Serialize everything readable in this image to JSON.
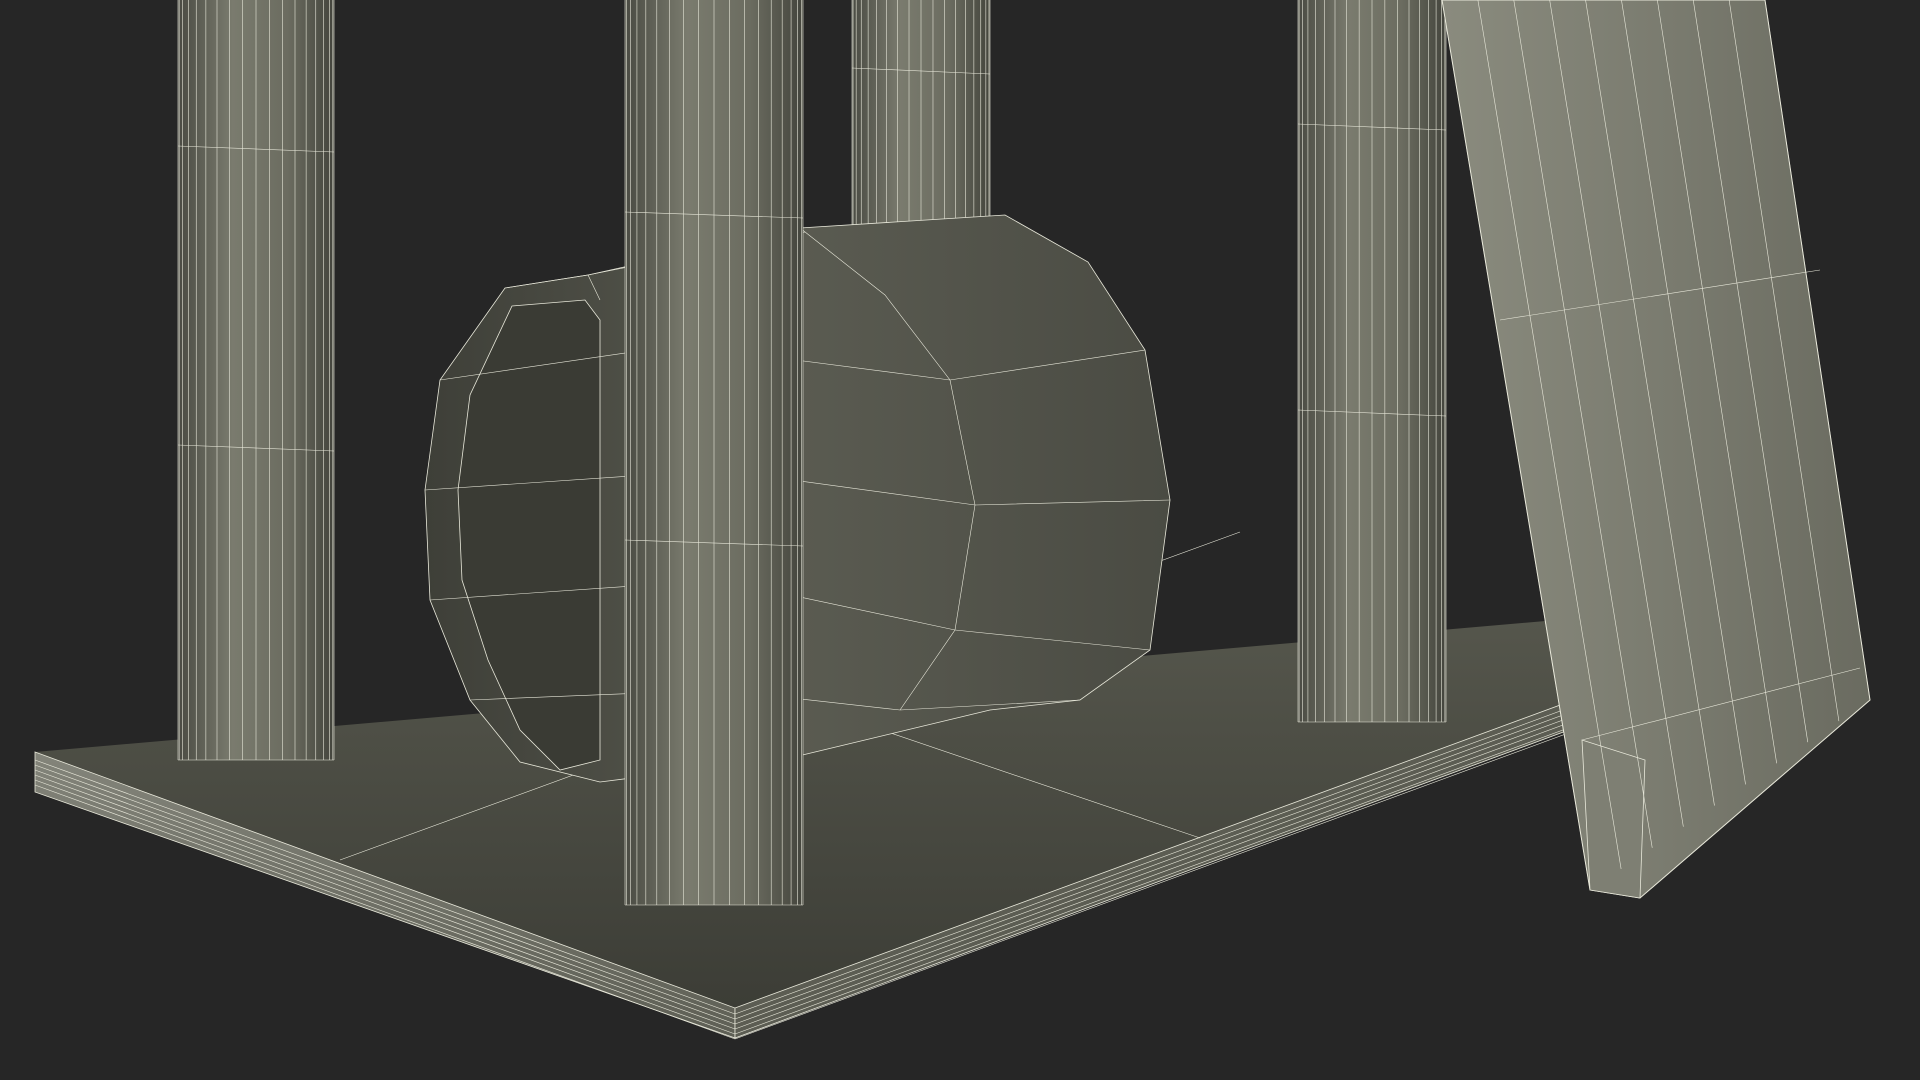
{
  "scene": {
    "background_color": "#262626",
    "surface_color": "#6f7064",
    "wire_color": "#e8e8da",
    "objects": [
      "base-platform",
      "post-back-left",
      "post-back-center",
      "post-back-right",
      "post-front-center",
      "tunnel",
      "ramp-board"
    ]
  }
}
